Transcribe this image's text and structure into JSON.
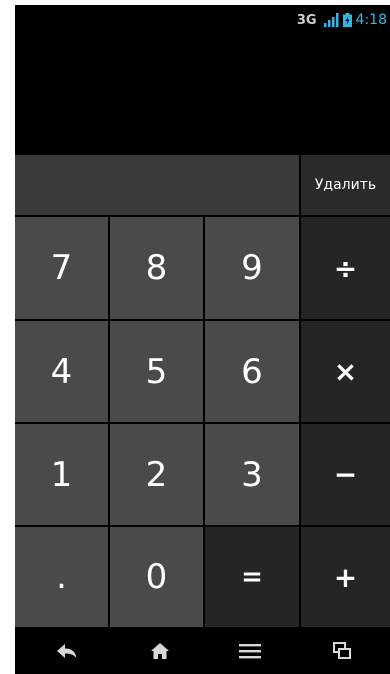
{
  "status_bar": {
    "network": "3G",
    "time": "4:18",
    "icons": [
      "signal-icon",
      "battery-charging-icon"
    ]
  },
  "display": {
    "formula": ""
  },
  "delete_label": "Удалить",
  "keys": {
    "seven": "7",
    "eight": "8",
    "nine": "9",
    "divide": "÷",
    "four": "4",
    "five": "5",
    "six": "6",
    "multiply": "×",
    "one": "1",
    "two": "2",
    "three": "3",
    "minus": "−",
    "dot": ".",
    "zero": "0",
    "equals": "=",
    "plus": "+"
  },
  "navbar": {
    "icons": [
      "back-icon",
      "home-icon",
      "menu-icon",
      "recent-apps-icon"
    ]
  },
  "colors": {
    "number_key": "#4a4a4a",
    "operator_key": "#252525",
    "clock": "#33b5e5"
  }
}
